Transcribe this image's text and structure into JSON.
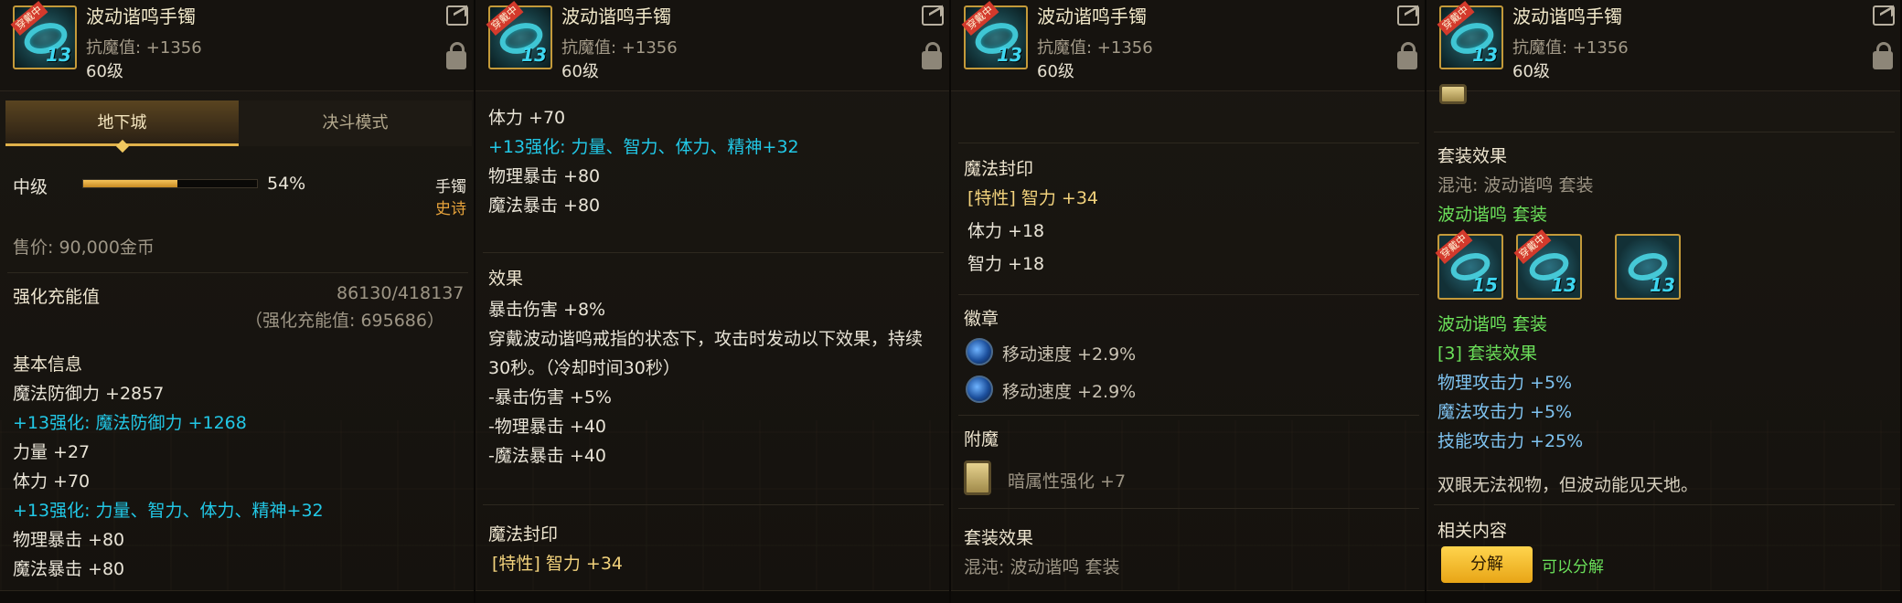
{
  "item": {
    "name": "波动谐鸣手镯",
    "resist": "抗魔值: +1356",
    "level": "60级",
    "badge": "穿戴中",
    "grade_tag": "6"
  },
  "enhance_level": "13",
  "panel1": {
    "tab_dungeon": "地下城",
    "tab_duel": "决斗模式",
    "grade_label": "中级",
    "grade_percent_text": "54%",
    "grade_fraction": 0.54,
    "slot": "手镯",
    "rarity": "史诗",
    "price": "售价: 90,000金币",
    "reinforce_label": "强化充能值",
    "reinforce_value": "86130/418137",
    "reinforce_sub": "（强化充能值: 695686）",
    "basic_info_label": "基本信息",
    "lines": [
      {
        "text": "魔法防御力 +2857",
        "color": "white"
      },
      {
        "text": "+13强化: 魔法防御力 +1268",
        "color": "cyan"
      },
      {
        "text": "力量 +27",
        "color": "white"
      },
      {
        "text": "体力 +70",
        "color": "white"
      },
      {
        "text": "+13强化: 力量、智力、体力、精神+32",
        "color": "cyan"
      },
      {
        "text": "物理暴击 +80",
        "color": "white"
      },
      {
        "text": "魔法暴击 +80",
        "color": "white"
      }
    ]
  },
  "panel2": {
    "top_lines": [
      {
        "text": "体力 +70",
        "color": "white"
      },
      {
        "text": "+13强化: 力量、智力、体力、精神+32",
        "color": "cyan"
      },
      {
        "text": "物理暴击 +80",
        "color": "white"
      },
      {
        "text": "魔法暴击 +80",
        "color": "white"
      }
    ],
    "effect_label": "效果",
    "effect_lines": [
      "暴击伤害 +8%",
      "穿戴波动谐鸣戒指的状态下，攻击时发动以下效果，持续",
      "30秒。（冷却时间30秒）",
      "-暴击伤害 +5%",
      "-物理暴击 +40",
      "-魔法暴击 +40"
    ],
    "seal_label": "魔法封印",
    "seal_line": "[特性] 智力 +34"
  },
  "panel3": {
    "seal_label": "魔法封印",
    "seal_lines": [
      {
        "text": "[特性] 智力 +34",
        "color": "yellow"
      },
      {
        "text": "体力 +18",
        "color": "white"
      },
      {
        "text": "智力 +18",
        "color": "white"
      }
    ],
    "emblem_label": "徽章",
    "emblems": [
      "移动速度 +2.9%",
      "移动速度 +2.9%"
    ],
    "enchant_label": "附魔",
    "enchant_line": "暗属性强化 +7",
    "set_label": "套装效果",
    "set_line": "混沌: 波动谐鸣 套装"
  },
  "panel4": {
    "set_label": "套装效果",
    "chaos_line": "混沌: 波动谐鸣 套装",
    "set_name_line": "波动谐鸣 套装",
    "set_icons": [
      {
        "level": "15",
        "badge": "穿戴中"
      },
      {
        "level": "13",
        "badge": "穿戴中"
      },
      {
        "level": "13",
        "badge": ""
      }
    ],
    "set_name_line2": "波动谐鸣 套装",
    "bonus_header": "[3] 套装效果",
    "bonus_lines": [
      "物理攻击力 +5%",
      "魔法攻击力 +5%",
      "技能攻击力 +25%"
    ],
    "flavor": "双眼无法视物，但波动能见天地。",
    "related_label": "相关内容",
    "disassemble_button": "分解",
    "disassemble_note": "可以分解"
  }
}
